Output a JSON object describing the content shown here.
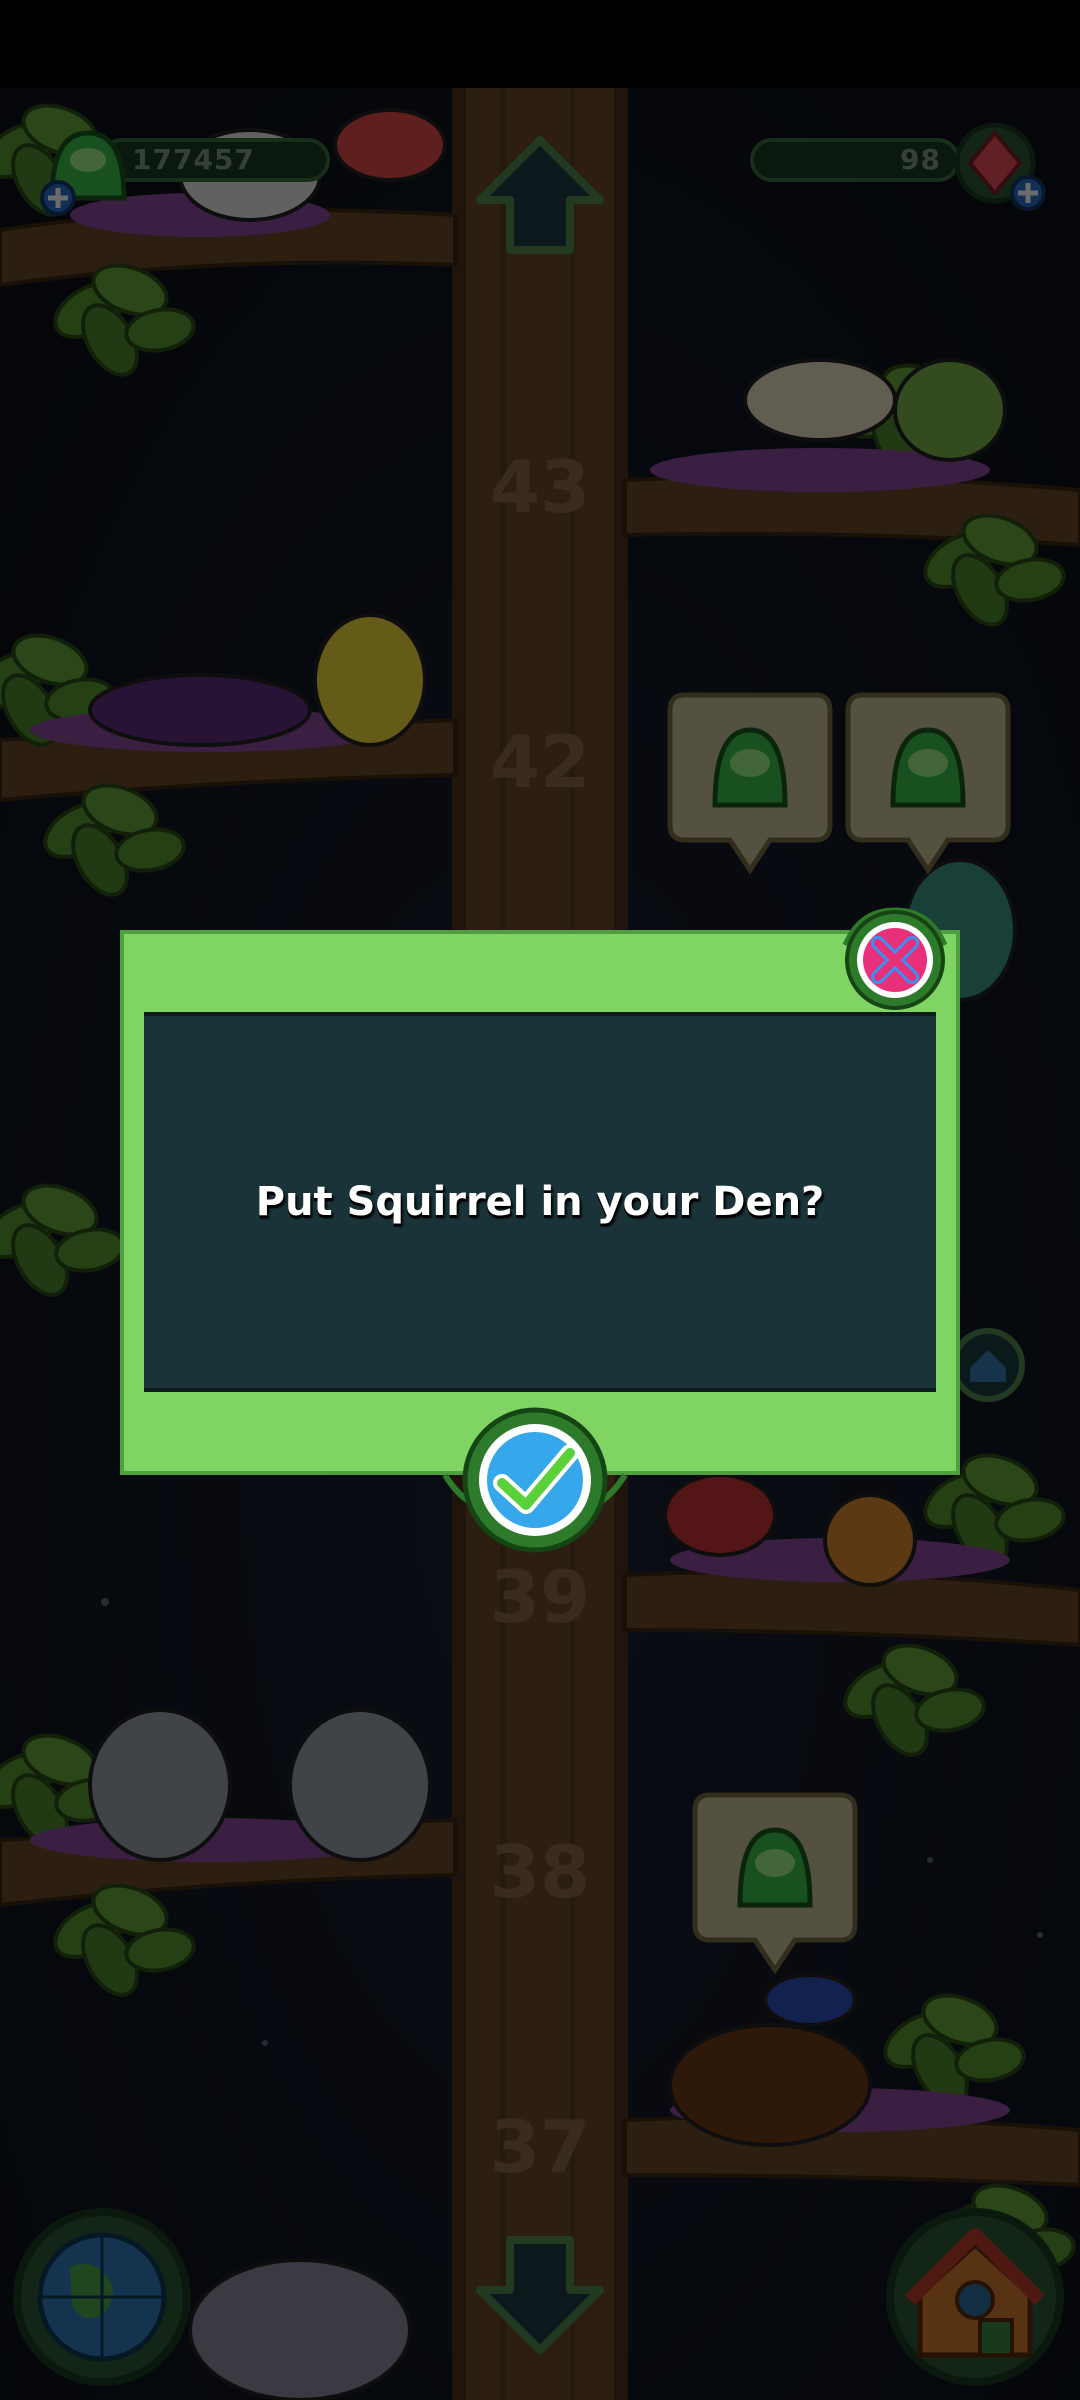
{
  "hud": {
    "coins": "177457",
    "gems": "98",
    "coins_icon": "green-gumdrop-icon",
    "gems_icon": "red-crystal-icon"
  },
  "branches": [
    {
      "level": "43"
    },
    {
      "level": "42"
    },
    {
      "level": "39"
    },
    {
      "level": "38"
    },
    {
      "level": "37"
    }
  ],
  "dialog": {
    "message": "Put Squirrel in your Den?",
    "close_icon": "close-x-icon",
    "confirm_icon": "checkmark-icon"
  },
  "colors": {
    "dialog_frame": "#7fd463",
    "dialog_panel": "#193339",
    "close_accent": "#e8307a",
    "confirm_accent": "#36a7ea",
    "trunk": "#6a4a2c",
    "leaf": "#4f8a2e"
  }
}
